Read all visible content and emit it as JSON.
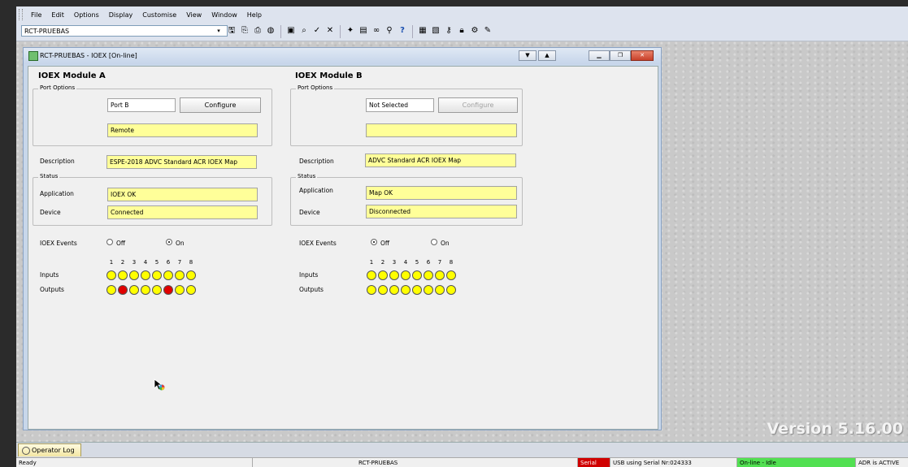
{
  "menubar": {
    "items": [
      "File",
      "Edit",
      "Options",
      "Display",
      "Customise",
      "View",
      "Window",
      "Help"
    ]
  },
  "toolbar": {
    "combo_value": "RCT-PRUEBAS",
    "icons": [
      "disk-icon",
      "copy-icon",
      "print-icon",
      "globe-icon",
      "panel-icon",
      "zoom-icon",
      "check-icon",
      "cross-icon",
      "color-icon",
      "page-icon",
      "binoculars-icon",
      "search-icon",
      "help-icon",
      "grid-icon",
      "doc-icon",
      "key-icon",
      "lock-icon",
      "wrench-icon",
      "pencil-icon"
    ]
  },
  "window": {
    "title": "RCT-PRUEBAS - IOEX [On-line]"
  },
  "module_a": {
    "heading": "IOEX Module A",
    "port_options_label": "Port Options",
    "port_value": "Port B",
    "configure_label": "Configure",
    "port_status": "Remote",
    "description_label": "Description",
    "description_value": "ESPE-2018 ADVC Standard ACR IOEX Map",
    "status_label": "Status",
    "application_label": "Application",
    "application_value": "IOEX OK",
    "device_label": "Device",
    "device_value": "Connected",
    "events_label": "IOEX Events",
    "off_label": "Off",
    "on_label": "On",
    "events_selected": "On",
    "inputs_label": "Inputs",
    "outputs_label": "Outputs",
    "channel_numbers": [
      "1",
      "2",
      "3",
      "4",
      "5",
      "6",
      "7",
      "8"
    ],
    "inputs": [
      0,
      0,
      0,
      0,
      0,
      0,
      0,
      0
    ],
    "outputs": [
      0,
      1,
      0,
      0,
      0,
      1,
      0,
      0
    ]
  },
  "module_b": {
    "heading": "IOEX Module B",
    "port_options_label": "Port Options",
    "port_value": "Not Selected",
    "configure_label": "Configure",
    "port_status": "",
    "description_label": "Description",
    "description_value": "ADVC Standard ACR IOEX Map",
    "status_label": "Status",
    "application_label": "Application",
    "application_value": "Map OK",
    "device_label": "Device",
    "device_value": "Disconnected",
    "events_label": "IOEX Events",
    "off_label": "Off",
    "on_label": "On",
    "events_selected": "Off",
    "inputs_label": "Inputs",
    "outputs_label": "Outputs",
    "channel_numbers": [
      "1",
      "2",
      "3",
      "4",
      "5",
      "6",
      "7",
      "8"
    ],
    "inputs": [
      0,
      0,
      0,
      0,
      0,
      0,
      0,
      0
    ],
    "outputs": [
      0,
      0,
      0,
      0,
      0,
      0,
      0,
      0
    ]
  },
  "desktop": {
    "version_text": "Version 5.16.00"
  },
  "operator_log": {
    "tab_label": "Operator Log"
  },
  "statusbar": {
    "ready": "Ready",
    "device": "RCT-PRUEBAS",
    "conn_flag": "Serial",
    "connection": "USB using Serial Nr:024333",
    "state": "On-line - Idle",
    "adr": "ADR is ACTIVE"
  },
  "colors": {
    "led_on": "#ffff00",
    "led_red": "#e00000",
    "field_yellow": "#ffff99",
    "state_green": "#52e052",
    "flag_red": "#d00000"
  }
}
